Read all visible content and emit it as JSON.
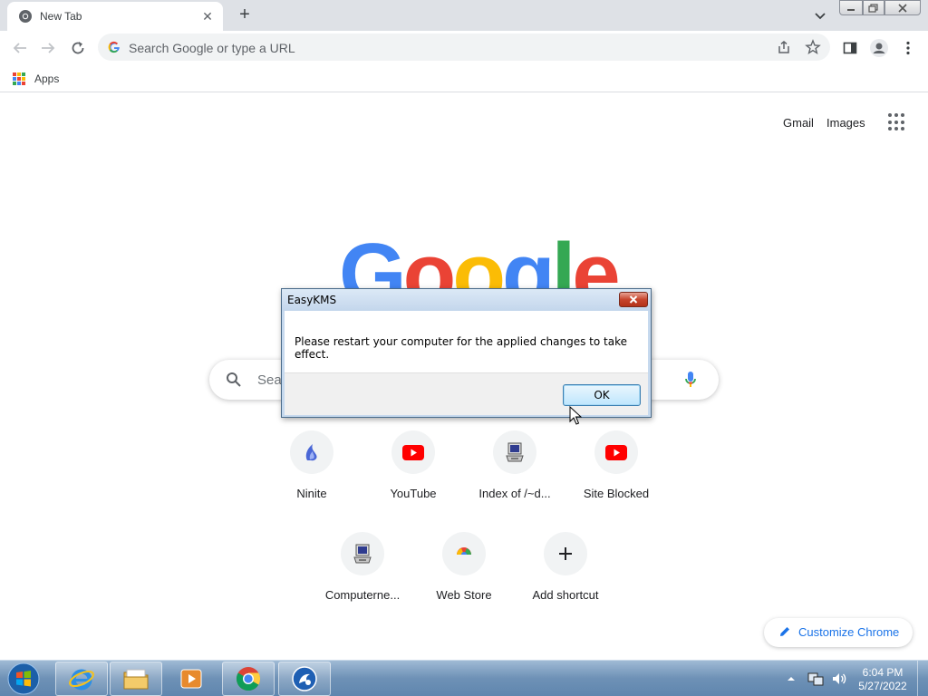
{
  "browser": {
    "tab": {
      "title": "New Tab",
      "favicon": "chrome-icon",
      "close": "close-icon"
    },
    "new_tab": "+",
    "omnibox": {
      "placeholder": "Search Google or type a URL"
    },
    "bookmarks": [
      {
        "label": "Apps",
        "icon": "apps-grid-icon"
      }
    ]
  },
  "ntp": {
    "header_links": [
      "Gmail",
      "Images"
    ],
    "logo_letters": [
      {
        "ch": "G",
        "color": "#4285f4"
      },
      {
        "ch": "o",
        "color": "#ea4335"
      },
      {
        "ch": "o",
        "color": "#fbbc05"
      },
      {
        "ch": "g",
        "color": "#4285f4"
      },
      {
        "ch": "l",
        "color": "#34a853"
      },
      {
        "ch": "e",
        "color": "#ea4335"
      }
    ],
    "search_placeholder": "Sea",
    "shortcuts": [
      {
        "label": "Ninite",
        "icon": "ninite-icon"
      },
      {
        "label": "YouTube",
        "icon": "youtube-icon"
      },
      {
        "label": "Index of /~d...",
        "icon": "computer-icon"
      },
      {
        "label": "Site Blocked",
        "icon": "youtube-icon"
      },
      {
        "label": "Computerne...",
        "icon": "computer-icon"
      },
      {
        "label": "Web Store",
        "icon": "webstore-icon"
      },
      {
        "label": "Add shortcut",
        "icon": "plus-icon"
      }
    ],
    "customize_label": "Customize Chrome"
  },
  "dialog": {
    "title": "EasyKMS",
    "message": "Please restart your computer for the applied changes to take effect.",
    "ok_label": "OK"
  },
  "taskbar": {
    "apps": [
      "internet-explorer-icon",
      "file-explorer-icon",
      "media-player-icon",
      "chrome-icon",
      "easykms-icon"
    ],
    "time": "6:04 PM",
    "date": "5/27/2022"
  },
  "colors": {
    "accent": "#1a73e8",
    "youtube": "#ff0000"
  }
}
